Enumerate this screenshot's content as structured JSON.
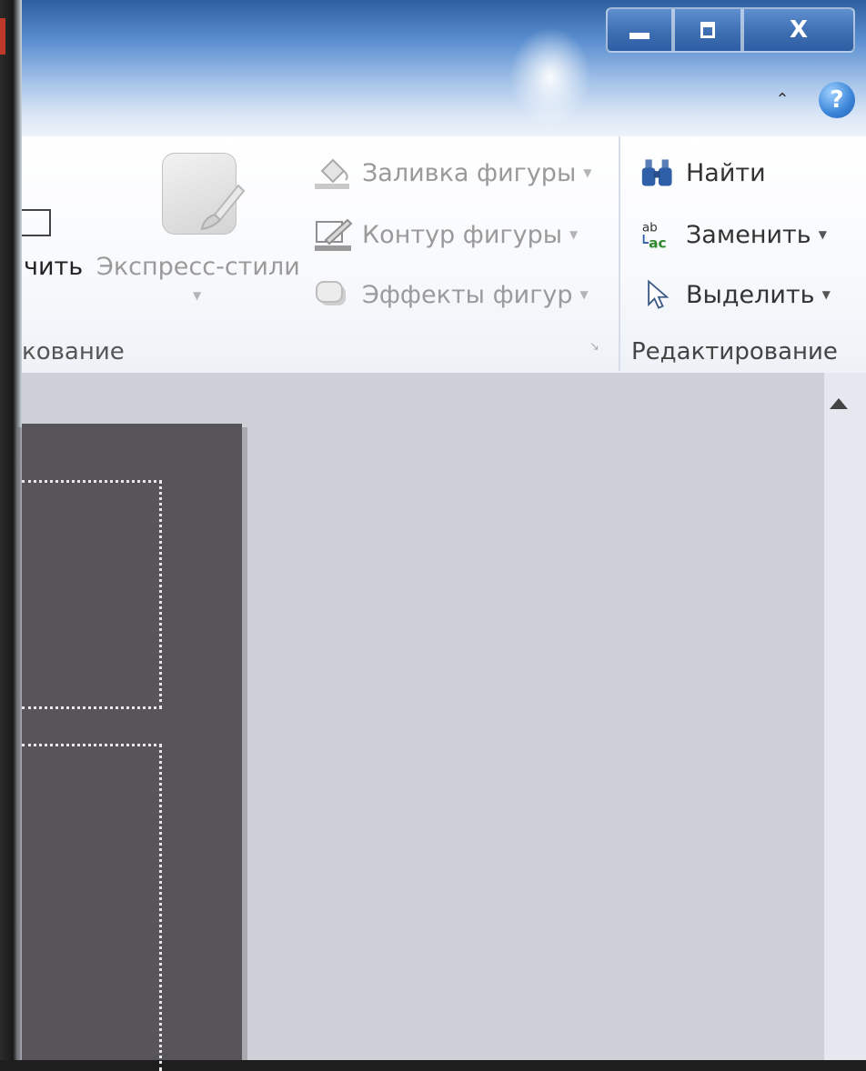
{
  "window": {
    "minimize_label": "",
    "maximize_label": "",
    "close_label": "X"
  },
  "ribbon": {
    "drawing_group": {
      "arrange_label": "чить",
      "express_styles_label": "Экспресс-стили",
      "group_title": "кование",
      "commands": [
        {
          "label": "Заливка фигуры",
          "icon": "paint-bucket-icon",
          "enabled": false
        },
        {
          "label": "Контур фигуры",
          "icon": "pencil-outline-icon",
          "enabled": false
        },
        {
          "label": "Эффекты фигур",
          "icon": "shape-effects-icon",
          "enabled": false
        }
      ]
    },
    "editing_group": {
      "group_title": "Редактирование",
      "commands": [
        {
          "label": "Найти",
          "icon": "binoculars-icon",
          "has_dropdown": false
        },
        {
          "label": "Заменить",
          "icon": "replace-ab-ac-icon",
          "has_dropdown": true
        },
        {
          "label": "Выделить",
          "icon": "cursor-arrow-icon",
          "has_dropdown": true
        }
      ]
    },
    "help_label": "?",
    "collapse_glyph": "^"
  },
  "colors": {
    "titlebar": "#5b8fd0",
    "close_button": "#3e6fb3",
    "workspace": "#cdd0d6",
    "slide": "#575559"
  }
}
